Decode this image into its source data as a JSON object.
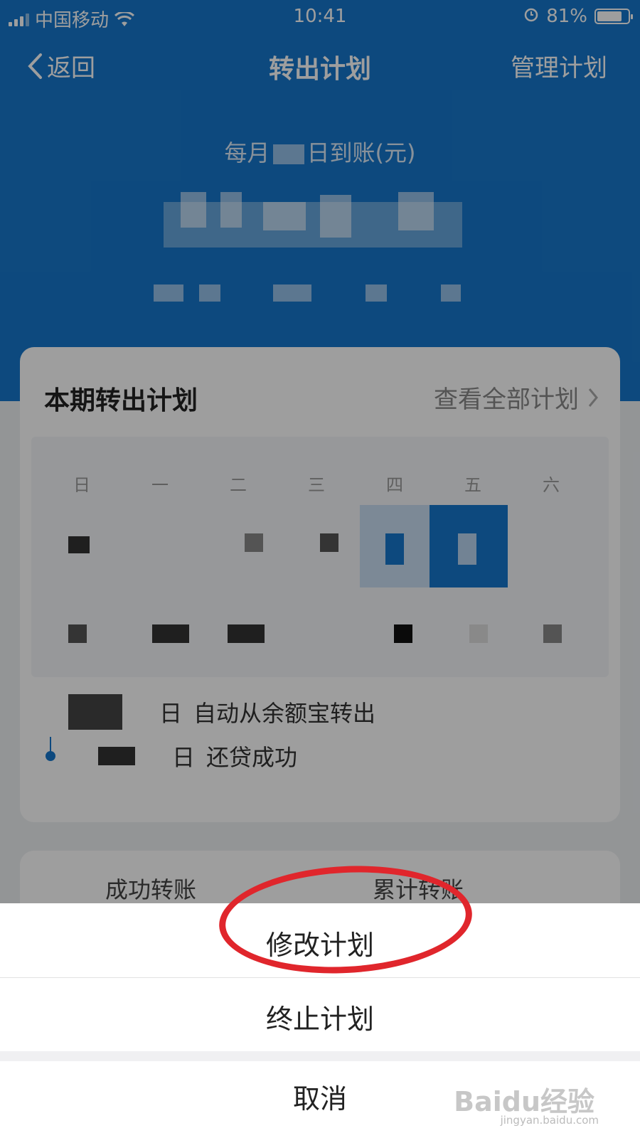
{
  "status_bar": {
    "carrier": "中国移动",
    "time": "10:41",
    "battery": "81%",
    "battery_level": 0.81,
    "icons": [
      "signal-icon",
      "wifi-icon",
      "alarm-icon",
      "battery-icon"
    ]
  },
  "nav": {
    "back_label": "返回",
    "title": "转出计划",
    "manage_label": "管理计划"
  },
  "summary": {
    "subtitle_prefix": "每月",
    "subtitle_suffix": "日到账(元)"
  },
  "plan_card": {
    "title": "本期转出计划",
    "view_all_label": "查看全部计划",
    "weekdays": [
      "日",
      "一",
      "二",
      "三",
      "四",
      "五",
      "六"
    ],
    "legend": [
      {
        "date_suffix": "日",
        "text": "自动从余额宝转出"
      },
      {
        "date_suffix": "日",
        "text": "还贷成功"
      }
    ]
  },
  "stats_card": {
    "left_label": "成功转账",
    "right_label": "累计转账"
  },
  "action_sheet": {
    "modify_label": "修改计划",
    "stop_label": "终止计划",
    "cancel_label": "取消"
  },
  "watermark": {
    "brand": "Baidu经验",
    "url": "jingyan.baidu.com"
  },
  "colors": {
    "brand_blue": "#1677cc",
    "annotation_red": "#e0262c"
  }
}
